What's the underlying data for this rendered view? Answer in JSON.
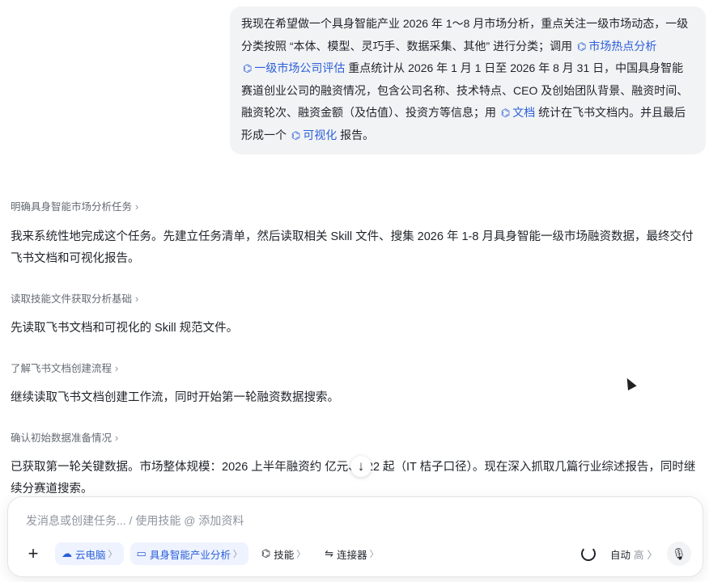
{
  "user_message": {
    "p1": "我现在希望做一个具身智能产业 2026 年 1～8 月市场分析，重点关注一级市场动态，一级分类按照 “本体、模型、灵巧手、数据采集、其他” 进行分类；调用",
    "skill1": "市场热点分析",
    "skill2": "一级市场公司评估",
    "p2": "重点统计从 2026 年 1 月 1 日至 2026 年 8 月 31 日，中国具身智能赛道创业公司的融资情况，包含公司名称、技术特点、CEO 及创始团队背景、融资时间、融资轮次、融资金额（及估值）、投资方等信息；用",
    "skill3": "文档",
    "p3": "统计在飞书文档内。并且最后形成一个",
    "skill4": "可视化",
    "p4": "报告。"
  },
  "steps": [
    {
      "title": "明确具身智能市场分析任务",
      "text": "我来系统性地完成这个任务。先建立任务清单，然后读取相关 Skill 文件、搜集 2026 年 1-8 月具身智能一级市场融资数据，最终交付飞书文档和可视化报告。"
    },
    {
      "title": "读取技能文件获取分析基础",
      "text": "先读取飞书文档和可视化的 Skill 规范文件。"
    },
    {
      "title": "了解飞书文档创建流程",
      "text": "继续读取飞书文档创建工作流，同时开始第一轮融资数据搜索。"
    },
    {
      "title": "确认初始数据准备情况",
      "text": "已获取第一轮关键数据。市场整体规模：2026 上半年融资约    亿元、322 起（IT 桔子口径）。现在深入抓取几篇行业综述报告，同时继续分赛道搜索。"
    }
  ],
  "composer": {
    "placeholder": "发消息或创建任务... / 使用技能 @ 添加资料",
    "chip_cloud": "云电脑",
    "chip_project": "具身智能产业分析",
    "chip_skill": "技能",
    "chip_connector": "连接器",
    "mode": "自动",
    "mode_level": "高"
  },
  "icons": {
    "skill": "skill-icon",
    "chevron": "chevron-right-icon",
    "scroll": "arrow-down-icon",
    "plus": "plus-icon",
    "cloud": "cloud-icon",
    "folder": "folder-icon",
    "connector": "connector-icon",
    "spinner": "spinner-icon",
    "mic": "mic-icon"
  },
  "colors": {
    "accent": "#2b5fd9",
    "bubble": "#f2f3f5",
    "muted": "#646a73"
  }
}
